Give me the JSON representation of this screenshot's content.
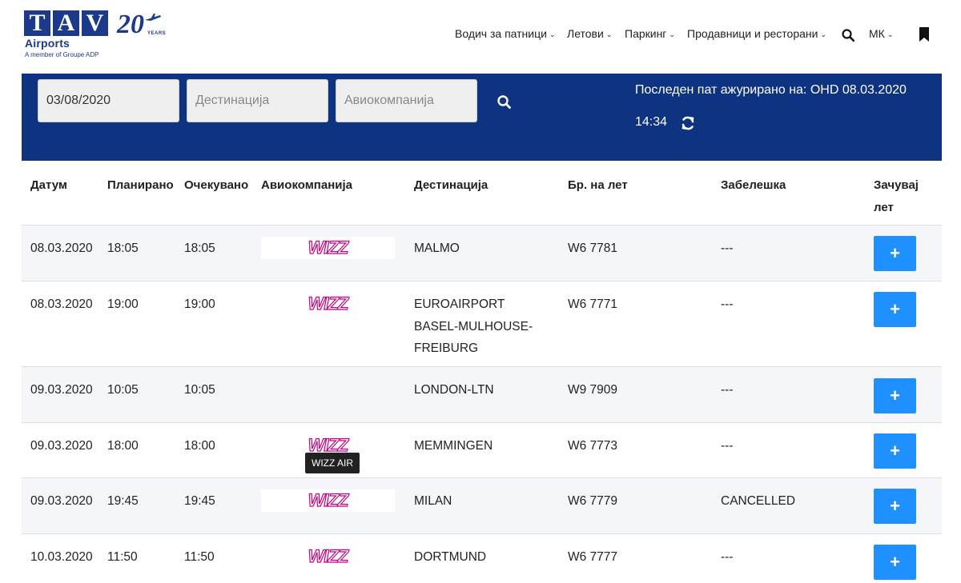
{
  "logo": {
    "letters": [
      "T",
      "A",
      "V"
    ],
    "airports": "Airports",
    "member": "A member of Groupe ADP",
    "anniversary": "20",
    "years": "YEARS",
    "icon": "plane-icon"
  },
  "nav": {
    "items": [
      "Водич за патници",
      "Летови",
      "Паркинг",
      "Продавници и ресторани"
    ],
    "language": "МК",
    "search_icon": "search-icon",
    "bookmark_icon": "bookmark-icon"
  },
  "search": {
    "date_value": "03/08/2020",
    "destination_placeholder": "Дестинација",
    "airline_placeholder": "Авиокомпанија",
    "last_updated": "Последен пат ажурирано на: OHD 08.03.2020",
    "last_updated_time": "14:34"
  },
  "table": {
    "headers": [
      "Датум",
      "Планирано",
      "Очекувано",
      "Авиокомпанија",
      "Дестинација",
      "Бр. на лет",
      "Забелешка",
      "Зачувај",
      "лет"
    ],
    "rows": [
      {
        "date": "08.03.2020",
        "planned": "18:05",
        "expected": "18:05",
        "airline": "WIZZ",
        "destination": "MALMO",
        "flight": "W6 7781",
        "note": "---",
        "add": "+"
      },
      {
        "date": "08.03.2020",
        "planned": "19:00",
        "expected": "19:00",
        "airline": "WIZZ",
        "destination": "EUROAIRPORT BASEL-MULHOUSE-FREIBURG",
        "dest_lines": [
          "EUROAIRPORT",
          "BASEL-MULHOUSE-",
          "FREIBURG"
        ],
        "flight": "W6 7771",
        "note": "---",
        "add": "+"
      },
      {
        "date": "09.03.2020",
        "planned": "10:05",
        "expected": "10:05",
        "airline": "",
        "destination": "LONDON-LTN",
        "flight": "W9 7909",
        "note": "---",
        "add": "+"
      },
      {
        "date": "09.03.2020",
        "planned": "18:00",
        "expected": "18:00",
        "airline": "WIZZ",
        "destination": "MEMMINGEN",
        "flight": "W6 7773",
        "note": "---",
        "add": "+"
      },
      {
        "date": "09.03.2020",
        "planned": "19:45",
        "expected": "19:45",
        "airline": "WIZZ",
        "destination": "MILAN",
        "flight": "W6 7779",
        "note": "CANCELLED",
        "add": "+"
      },
      {
        "date": "10.03.2020",
        "planned": "11:50",
        "expected": "11:50",
        "airline": "WIZZ",
        "destination": "DORTMUND",
        "flight": "W6 7777",
        "note": "---",
        "add": "+"
      }
    ]
  },
  "tooltip": "WIZZ AIR",
  "colors": {
    "brand_blue": "#0e3380",
    "logo_blue": "#1d3a8a",
    "button_blue": "#1e90ff",
    "wizz_pink": "#c6007e"
  }
}
